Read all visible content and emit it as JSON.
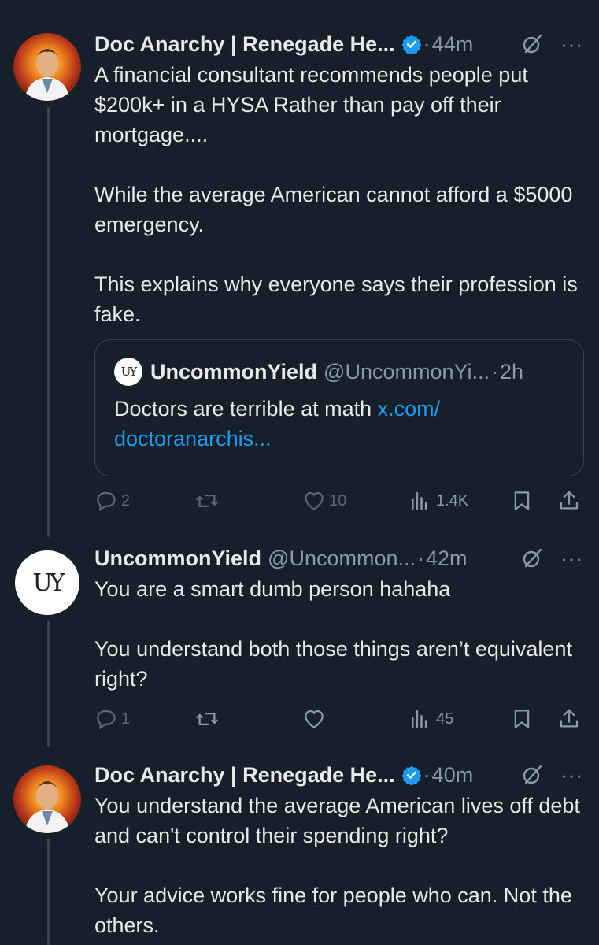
{
  "tweets": [
    {
      "name": "Doc Anarchy | Renegade He...",
      "handle": "",
      "time": "44m",
      "text": "A financial consultant recommends people put $200k+ in a HYSA Rather than pay off their mortgage....\n\nWhile the average American cannot afford a $5000 emergency.\n\nThis explains why everyone says their profession is fake.",
      "quote": {
        "name": "UncommonYield",
        "handle": "@UncommonYi...",
        "time": "2h",
        "text": "Doctors are terrible at math ",
        "link": "x.com/\ndoctoranarchis..."
      },
      "stats": {
        "replies": "2",
        "reposts": "",
        "likes": "10",
        "views": "1.4K"
      }
    },
    {
      "name": "UncommonYield",
      "handle": "@Uncommon...",
      "time": "42m",
      "text": "You are a smart dumb person hahaha\n\nYou understand both those things aren’t equivalent right?",
      "stats": {
        "replies": "1",
        "reposts": "",
        "likes": "",
        "views": "45"
      }
    },
    {
      "name": "Doc Anarchy | Renegade He...",
      "handle": "",
      "time": "40m",
      "text": "You understand the average American lives off debt and can't control their spending right?\n\nYour advice works fine for people who can. Not the others."
    }
  ],
  "icons": {
    "verified": "verified-badge-icon",
    "grok": "grok-icon",
    "more": "more-icon",
    "reply": "reply-icon",
    "repost": "repost-icon",
    "like": "heart-icon",
    "views": "views-icon",
    "bookmark": "bookmark-icon",
    "share": "share-icon"
  },
  "colors": {
    "background": "#15202b",
    "text": "#e7e9ea",
    "muted": "#8b98a5",
    "link": "#1d9bf0",
    "border": "#38444d"
  },
  "more_glyph": "···",
  "dot": "·",
  "uy_mark": "UY"
}
